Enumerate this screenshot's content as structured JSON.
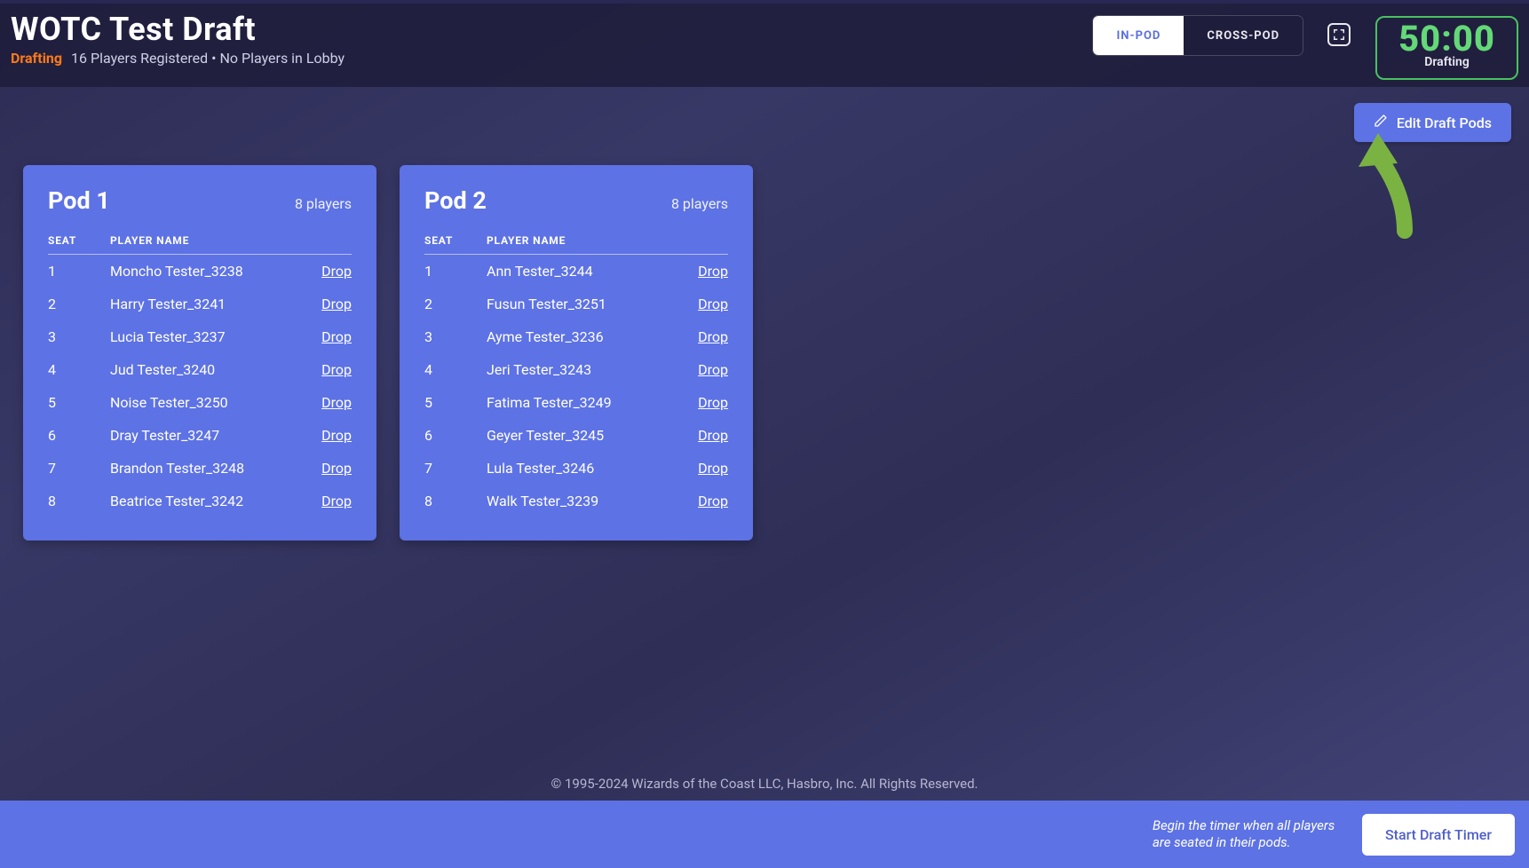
{
  "header": {
    "title": "WOTC Test Draft",
    "status": "Drafting",
    "players_info": "16 Players Registered • No Players in Lobby",
    "toggle": {
      "in_pod": "IN-POD",
      "cross_pod": "CROSS-POD"
    },
    "timer": {
      "time": "50:00",
      "label": "Drafting"
    }
  },
  "toolbar": {
    "edit_label": "Edit Draft Pods"
  },
  "table_headers": {
    "seat": "SEAT",
    "player_name": "PLAYER NAME"
  },
  "drop_label": "Drop",
  "pods": [
    {
      "title": "Pod 1",
      "count": "8 players",
      "players": [
        {
          "seat": "1",
          "name": "Moncho Tester_3238"
        },
        {
          "seat": "2",
          "name": "Harry Tester_3241"
        },
        {
          "seat": "3",
          "name": "Lucia Tester_3237"
        },
        {
          "seat": "4",
          "name": "Jud Tester_3240"
        },
        {
          "seat": "5",
          "name": "Noise Tester_3250"
        },
        {
          "seat": "6",
          "name": "Dray Tester_3247"
        },
        {
          "seat": "7",
          "name": "Brandon Tester_3248"
        },
        {
          "seat": "8",
          "name": "Beatrice Tester_3242"
        }
      ]
    },
    {
      "title": "Pod 2",
      "count": "8 players",
      "players": [
        {
          "seat": "1",
          "name": "Ann Tester_3244"
        },
        {
          "seat": "2",
          "name": "Fusun Tester_3251"
        },
        {
          "seat": "3",
          "name": "Ayme Tester_3236"
        },
        {
          "seat": "4",
          "name": "Jeri Tester_3243"
        },
        {
          "seat": "5",
          "name": "Fatima Tester_3249"
        },
        {
          "seat": "6",
          "name": "Geyer Tester_3245"
        },
        {
          "seat": "7",
          "name": "Lula Tester_3246"
        },
        {
          "seat": "8",
          "name": "Walk Tester_3239"
        }
      ]
    }
  ],
  "footer": {
    "copyright": "© 1995-2024 Wizards of the Coast LLC, Hasbro, Inc. All Rights Reserved.",
    "hint": "Begin the timer when all players are seated in their pods.",
    "start_label": "Start Draft Timer"
  }
}
